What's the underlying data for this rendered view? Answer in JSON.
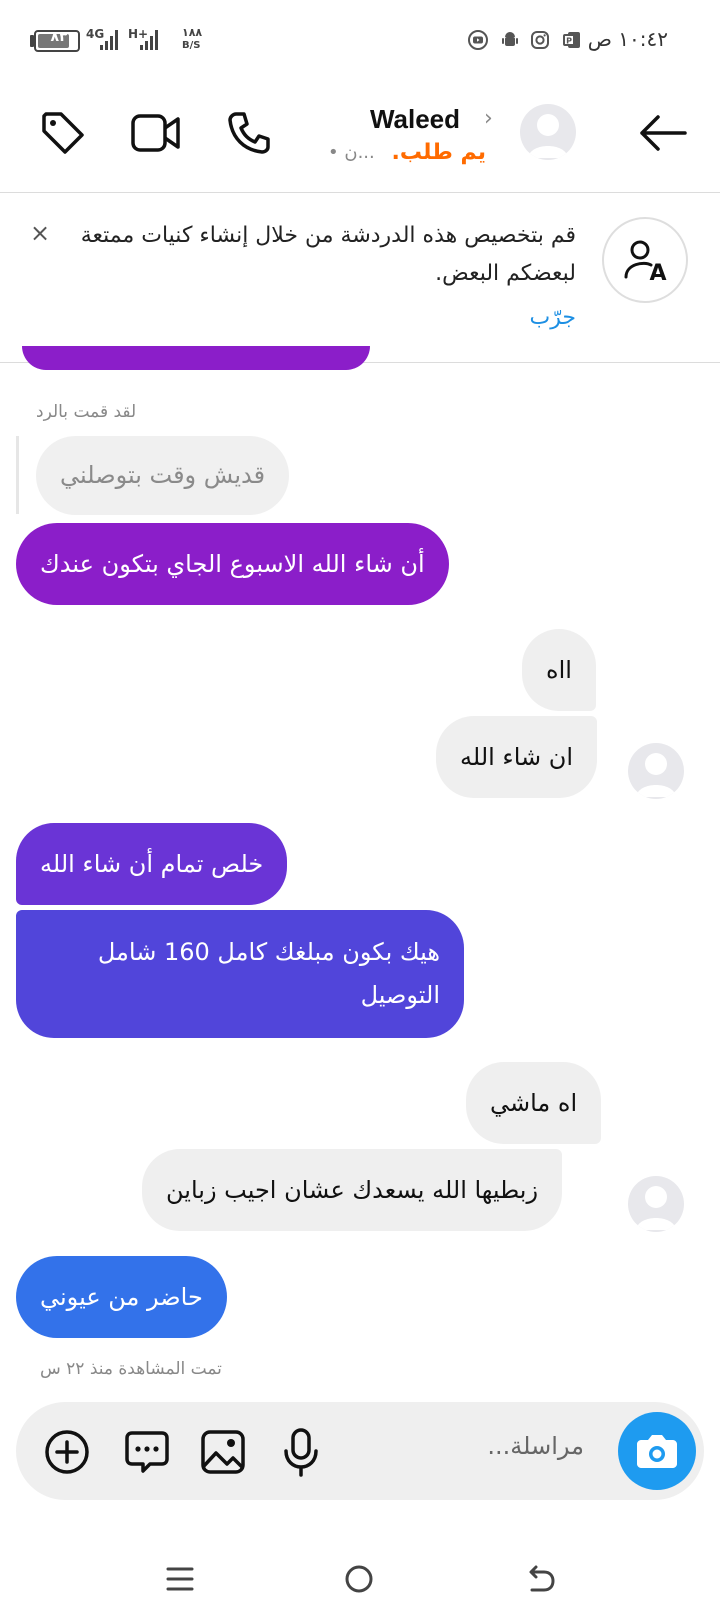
{
  "status_bar": {
    "time": "١٠:٤٢ ص",
    "battery": "٨٣",
    "battery_level": 0.83,
    "network_4g": "4G",
    "network_hplus": "H+",
    "speed_value": "١٨٨",
    "speed_unit": "B/S"
  },
  "header": {
    "contact_name": "Waleed",
    "subtitle_orange": ".يم طلب",
    "subtitle_gray": "• ن..."
  },
  "banner": {
    "text": "قم بتخصيص هذه الدردشة من خلال إنشاء كنيات ممتعة لبعضكم البعض.",
    "try_label": "جرّب",
    "close_label": "×"
  },
  "messages": {
    "reply_label": "لقد قمت بالرد",
    "quoted": "قديش وقت بتوصلني",
    "m1": "أن شاء الله الاسبوع الجاي بتكون عندك",
    "m2": "ااه",
    "m3": "ان شاء الله",
    "m4": "خلص تمام أن شاء الله",
    "m5": "هيك بكون مبلغك كامل 160 شامل التوصيل",
    "m6": "اه ماشي",
    "m7": "زبطيها الله يسعدك عشان اجيب زباين",
    "m8": "حاضر من عيوني",
    "seen": "تمت المشاهدة منذ ٢٢ س"
  },
  "composer": {
    "placeholder": "مراسلة..."
  },
  "colors": {
    "accent_blue": "#1e9bf0",
    "link_blue": "#1d8fe3",
    "orange": "#ff6b00",
    "bubble_purple": "#8b1ec9",
    "bubble_violet": "#5b3ee0",
    "bubble_blue": "#3372ea",
    "incoming_gray": "#efefef"
  },
  "icons": {
    "header": [
      "back-arrow-icon",
      "phone-icon",
      "video-camera-icon",
      "tag-icon"
    ],
    "composer": [
      "camera-icon",
      "microphone-icon",
      "gallery-icon",
      "chat-bubble-icon",
      "add-circle-icon"
    ],
    "nav": [
      "menu-icon",
      "home-circle-icon",
      "back-icon"
    ]
  }
}
